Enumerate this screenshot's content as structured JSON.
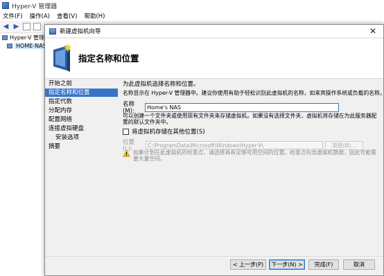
{
  "app": {
    "title": "Hyper-V 管理器",
    "menu": [
      "文件(F)",
      "操作(A)",
      "查看(V)",
      "帮助(H)"
    ],
    "tree": [
      {
        "label": "Hyper-V 管理器"
      },
      {
        "label": "HOME-NAS"
      }
    ]
  },
  "wizard": {
    "window_title": "新建虚拟机向导",
    "close_glyph": "✕",
    "header_title": "指定名称和位置",
    "steps": [
      {
        "label": "开始之前"
      },
      {
        "label": "指定名称和位置",
        "active": true
      },
      {
        "label": "指定代数"
      },
      {
        "label": "分配内存"
      },
      {
        "label": "配置网络"
      },
      {
        "label": "连接虚拟硬盘"
      },
      {
        "label": "安装选项",
        "sub": true
      },
      {
        "label": "摘要"
      }
    ],
    "intro": "为此虚拟机选择名称和位置。",
    "description": "名称显示在 Hyper-V 管理器中。建议你使用有助于轻松识别此虚拟机的名称，如来宾操作系统或负载的名称。",
    "name_label": "名称(M):",
    "name_value": "Home's NAS",
    "folder_description": "可以创建一个文件夹或使用现有文件夹来存储虚拟机。如果没有选择文件夹，虚拟机将存储在为此服务器配置的默认文件夹中。",
    "store_checkbox_label": "将虚拟机存储在其他位置(S)",
    "store_checked": false,
    "location_label": "位置(L):",
    "location_value": "C:\\ProgramData\\Microsoft\\Windows\\Hyper-V\\",
    "browse_label": "浏览(B)...",
    "warning": "如果计划在此虚拟机的检查点，请选择具有足够可用空间的位置。检查点包含虚拟机数据，因此可能需要大量空间。",
    "buttons": {
      "prev": "< 上一步(P)",
      "next": "下一步(N) >",
      "finish": "完成(F)",
      "cancel": "取消"
    }
  }
}
